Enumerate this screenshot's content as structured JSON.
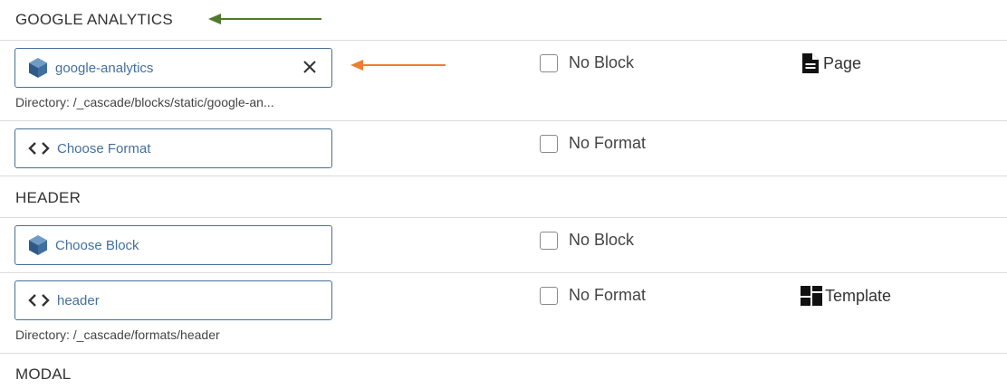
{
  "sections": {
    "google_analytics": "GOOGLE ANALYTICS",
    "header": "HEADER",
    "modal": "MODAL"
  },
  "rows": {
    "ga_block": {
      "chooser_value": "google-analytics",
      "directory": "Directory: /_cascade/blocks/static/google-an...",
      "checkbox_label": "No Block",
      "source": "Page"
    },
    "ga_format": {
      "chooser_value": "Choose Format",
      "checkbox_label": "No Format"
    },
    "header_block": {
      "chooser_value": "Choose Block",
      "checkbox_label": "No Block"
    },
    "header_format": {
      "chooser_value": "header",
      "directory": "Directory: /_cascade/formats/header",
      "checkbox_label": "No Format",
      "source": "Template"
    }
  },
  "icons": {
    "block": "cube-icon",
    "format": "code-brackets-icon",
    "clear": "close-icon",
    "page": "page-document-icon",
    "template": "template-grid-icon"
  },
  "colors": {
    "link_blue": "#44709e",
    "green_arrow": "#4f7a2e",
    "orange_arrow": "#ee7d34"
  }
}
